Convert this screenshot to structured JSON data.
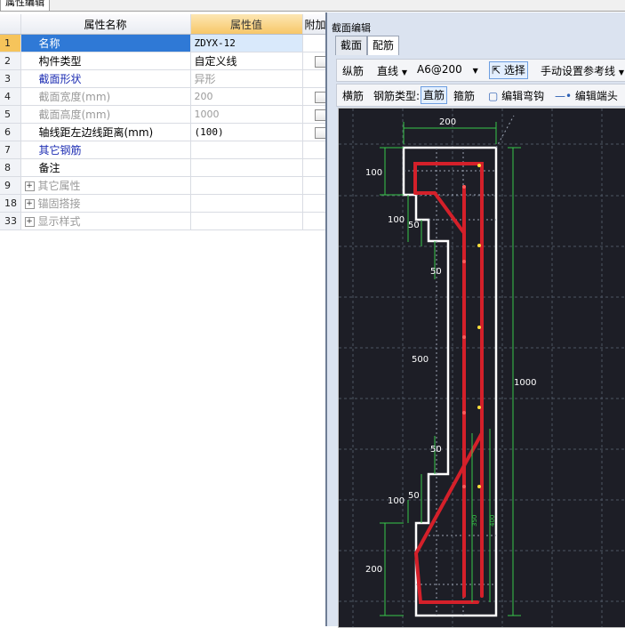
{
  "window_tab": "属性编辑",
  "grid": {
    "headers": {
      "name": "属性名称",
      "value": "属性值",
      "extra": "附加"
    },
    "rows": [
      {
        "num": "1",
        "name": "名称",
        "value": "ZDYX-12"
      },
      {
        "num": "2",
        "name": "构件类型",
        "value": "自定义线"
      },
      {
        "num": "3",
        "name": "截面形状",
        "value": "异形"
      },
      {
        "num": "4",
        "name": "截面宽度(mm)",
        "value": "200"
      },
      {
        "num": "5",
        "name": "截面高度(mm)",
        "value": "1000"
      },
      {
        "num": "6",
        "name": "轴线距左边线距离(mm)",
        "value": "(100)"
      },
      {
        "num": "7",
        "name": "其它钢筋",
        "value": ""
      },
      {
        "num": "8",
        "name": "备注",
        "value": ""
      },
      {
        "num": "9",
        "name": "其它属性",
        "value": ""
      },
      {
        "num": "18",
        "name": "锚固搭接",
        "value": ""
      },
      {
        "num": "33",
        "name": "显示样式",
        "value": ""
      }
    ]
  },
  "editor": {
    "title": "截面编辑",
    "tabs": [
      "截面",
      "配筋"
    ],
    "toolbar1": {
      "longitudinal": "纵筋",
      "line_type": "直线",
      "rebar_spec": "A6@200",
      "select": "选择",
      "manual_ref": "手动设置参考线"
    },
    "toolbar2": {
      "transverse": "横筋",
      "rebar_type_label": "钢筋类型:",
      "straight": "直筋",
      "stirrup": "箍筋",
      "edit_hook": "编辑弯钩",
      "edit_end": "编辑端头"
    },
    "dimensions": {
      "top_width": "200",
      "d100_top": "100",
      "d100_mid": "100",
      "d50_a": "50",
      "d50_b": "50",
      "d500": "500",
      "d50_c": "50",
      "d50_d": "50",
      "d100_low": "100",
      "d200_bottom": "200",
      "d1000": "1000",
      "d350": "350",
      "d400": "400"
    }
  },
  "colors": {
    "accent": "#f6c45b",
    "selection": "#2f79d6",
    "rebar": "#d4202a",
    "canvas": "#1d1e26"
  }
}
